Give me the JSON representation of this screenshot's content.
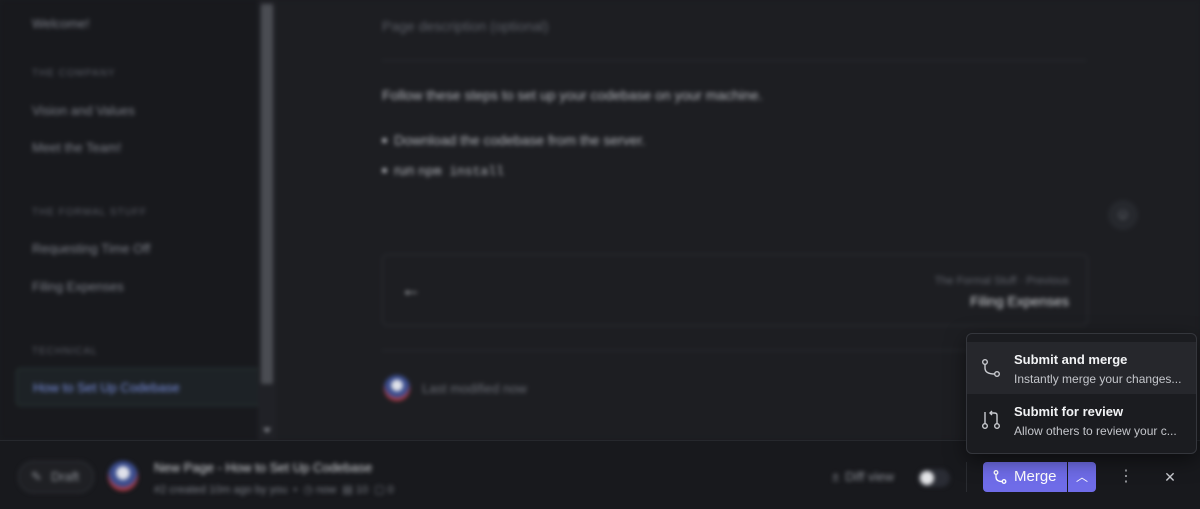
{
  "sidebar": {
    "items": [
      {
        "label": "Welcome!"
      },
      {
        "label": "Vision and Values"
      },
      {
        "label": "Meet the Team!"
      },
      {
        "label": "Requesting Time Off"
      },
      {
        "label": "Filing Expenses"
      }
    ],
    "sections": [
      "THE COMPANY",
      "THE FORMAL STUFF",
      "TECHNICAL"
    ],
    "active_item": "How to Set Up Codebase"
  },
  "main": {
    "description_placeholder": "Page description (optional)",
    "intro": "Follow these steps to set up your codebase on your machine.",
    "bullet_1": "Download the codebase from the server.",
    "bullet_2_prefix": "run",
    "bullet_2_code": "npm install",
    "prev_nav": {
      "subtitle": "The Formal Stuff · Previous",
      "title": "Filing Expenses"
    },
    "last_modified": "Last modified now"
  },
  "footer": {
    "draft_label": "Draft",
    "change_request_title": "New Page - How to Set Up Codebase",
    "change_request_meta": "#2 created 10m ago by you",
    "meta_time": "now",
    "meta_pages": "10",
    "meta_comments": "0",
    "diff_view_label": "Diff view",
    "diff_view_enabled": false,
    "merge_label": "Merge"
  },
  "merge_menu": {
    "options": [
      {
        "title": "Submit and merge",
        "description": "Instantly merge your changes..."
      },
      {
        "title": "Submit for review",
        "description": "Allow others to review your c..."
      }
    ]
  },
  "colors": {
    "accent": "#6f6ce8",
    "background": "#1b1c20"
  }
}
